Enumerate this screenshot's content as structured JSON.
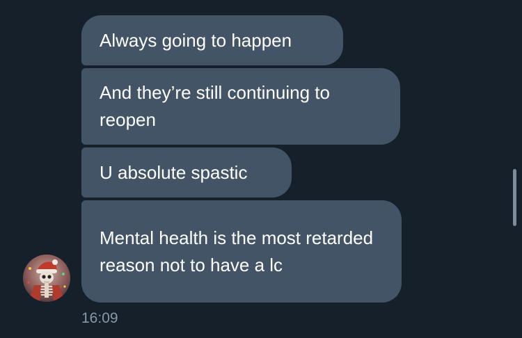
{
  "messages": [
    {
      "text": "Always going to happen"
    },
    {
      "text": "And they’re still continuing to reopen"
    },
    {
      "text": "U absolute spastic"
    },
    {
      "text": "Mental health is the most retarded reason not to have a lc"
    }
  ],
  "timestamp": "16:09",
  "avatar": {
    "icon": "skeleton-avatar-icon"
  },
  "colors": {
    "background": "#15202b",
    "bubble": "#425466",
    "text": "#ffffff",
    "timestamp": "#8899a6"
  }
}
